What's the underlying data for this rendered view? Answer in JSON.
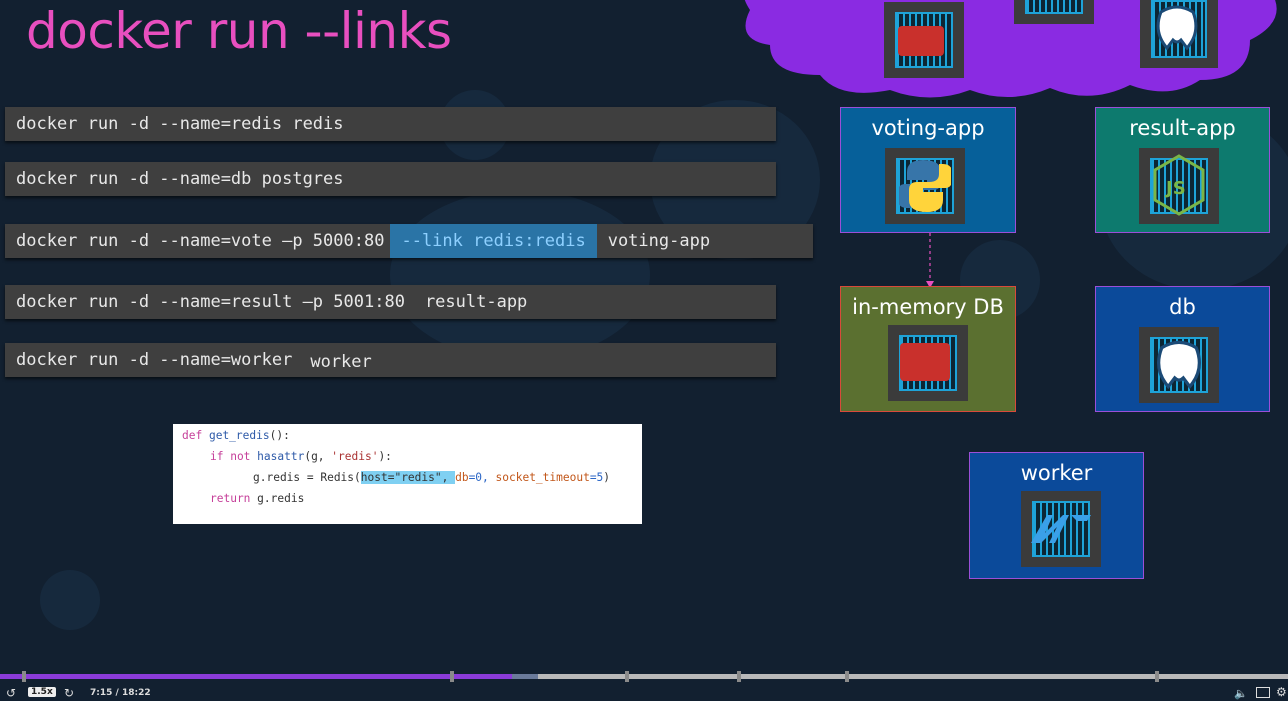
{
  "slide": {
    "title": "docker run --links",
    "commands": [
      {
        "text": "docker run -d --name=redis redis"
      },
      {
        "text": "docker run -d --name=db postgres"
      },
      {
        "text": "docker run -d --name=vote –p 5000:80",
        "highlight": "--link redis:redis",
        "arg": "voting-app"
      },
      {
        "text": "docker run -d --name=result –p 5001:80",
        "arg": "result-app"
      },
      {
        "text": "docker run -d --name=worker",
        "arg": "worker"
      }
    ],
    "code": {
      "line1": {
        "kw": "def",
        "fn": "get_redis",
        "rest": "():"
      },
      "line2": {
        "kw": "if not",
        "fn": "hasattr",
        "rest1": "(g, ",
        "str": "'redis'",
        "rest2": "):"
      },
      "line3": {
        "a": "g.redis = Redis(",
        "sel": "host=\"redis\", ",
        "k1": "db",
        "n1": "=0, ",
        "k2": "socket_timeout",
        "n2": "=5",
        "end": ")"
      },
      "line4": {
        "kw": "return",
        "rest": " g.redis"
      }
    },
    "boxes": [
      {
        "id": "voting-app",
        "label": "voting-app",
        "color": "#06609a",
        "border": "#9b4fd8",
        "icon": "python-icon"
      },
      {
        "id": "result-app",
        "label": "result-app",
        "color": "#0d7a6e",
        "border": "#9b4fd8",
        "icon": "nodejs-icon"
      },
      {
        "id": "in-memory-db",
        "label": "in-memory DB",
        "color": "#5b7030",
        "border": "#d94a3a",
        "icon": "redis-icon"
      },
      {
        "id": "db",
        "label": "db",
        "color": "#0b4a9a",
        "border": "#9b4fd8",
        "icon": "postgres-icon"
      },
      {
        "id": "worker",
        "label": "worker",
        "color": "#0b4a9a",
        "border": "#9b4fd8",
        "icon": "dotnet-icon"
      }
    ],
    "cloud_color": "#8a2be2"
  },
  "player": {
    "speed": "1.5x",
    "time": "7:15 / 18:22",
    "played_fraction": 0.4,
    "buffered_fraction": 0.42,
    "played_color": "#8b3bd9"
  }
}
